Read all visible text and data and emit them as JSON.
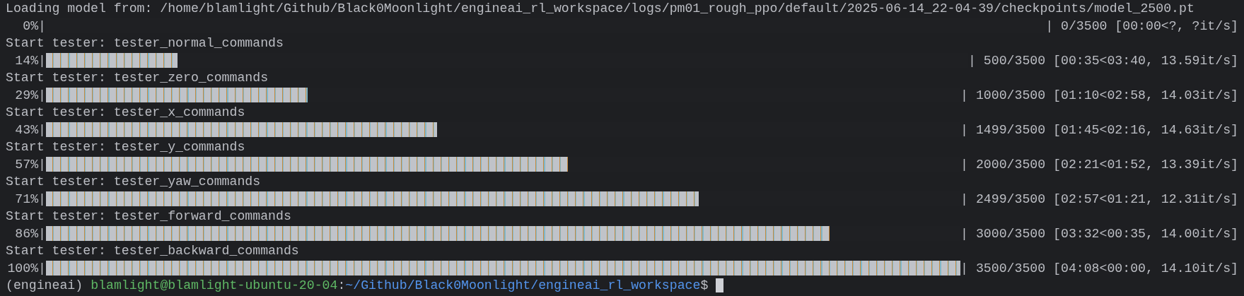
{
  "loading_line": "Loading model from: /home/blamlight/Github/Black0Moonlight/engineai_rl_workspace/logs/pm01_rough_ppo/default/2025-06-14_22-04-39/checkpoints/model_2500.pt",
  "initial_progress": {
    "percent": "0%|",
    "stats": "| 0/3500 [00:00<?, ?it/s]"
  },
  "testers": [
    {
      "label": "Start tester: tester_normal_commands",
      "progress": {
        "percent": "14%|",
        "level": 0.143,
        "stats": "| 500/3500 [00:35<03:40, 13.59it/s]"
      }
    },
    {
      "label": "Start tester: tester_zero_commands",
      "progress": {
        "percent": "29%|",
        "level": 0.286,
        "stats": "| 1000/3500 [01:10<02:58, 14.03it/s]"
      }
    },
    {
      "label": "Start tester: tester_x_commands",
      "progress": {
        "percent": "43%|",
        "level": 0.428,
        "stats": "| 1499/3500 [01:45<02:16, 14.63it/s]"
      }
    },
    {
      "label": "Start tester: tester_y_commands",
      "progress": {
        "percent": "57%|",
        "level": 0.571,
        "stats": "| 2000/3500 [02:21<01:52, 13.39it/s]"
      }
    },
    {
      "label": "Start tester: tester_yaw_commands",
      "progress": {
        "percent": "71%|",
        "level": 0.714,
        "stats": "| 2499/3500 [02:57<01:21, 12.31it/s]"
      }
    },
    {
      "label": "Start tester: tester_forward_commands",
      "progress": {
        "percent": "86%|",
        "level": 0.857,
        "stats": "| 3000/3500 [03:32<00:35, 14.00it/s]"
      }
    },
    {
      "label": "Start tester: tester_backward_commands",
      "progress": {
        "percent": "100%|",
        "level": 1,
        "stats": "| 3500/3500 [04:08<00:00, 14.10it/s]"
      }
    }
  ],
  "prompt": [
    {
      "kind": "env",
      "text": "(engineai)"
    },
    {
      "kind": "user",
      "text": "blamlight@blamlight-ubuntu-20-04"
    },
    {
      "kind": "sep",
      "text": ":"
    },
    {
      "kind": "path",
      "text": "~/Github/Black0Moonlight/engineai_rl_workspace"
    },
    {
      "kind": "sep",
      "text": "$"
    }
  ]
}
